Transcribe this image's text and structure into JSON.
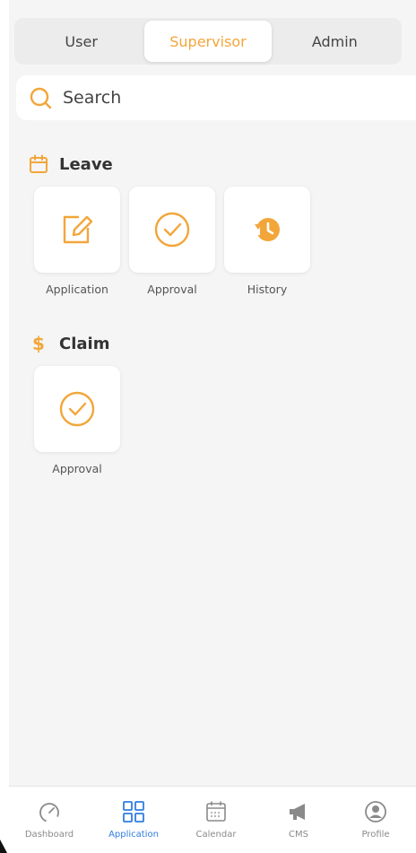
{
  "tabs": {
    "user": "User",
    "supervisor": "Supervisor",
    "admin": "Admin",
    "active": "supervisor"
  },
  "search": {
    "label": "Search"
  },
  "sections": {
    "leave": {
      "title": "Leave",
      "items": [
        {
          "label": "Application",
          "icon": "edit-icon"
        },
        {
          "label": "Approval",
          "icon": "check-circle-icon"
        },
        {
          "label": "History",
          "icon": "history-icon"
        }
      ]
    },
    "claim": {
      "title": "Claim",
      "items": [
        {
          "label": "Approval",
          "icon": "check-circle-icon"
        }
      ]
    }
  },
  "bottom_nav": {
    "items": [
      {
        "label": "Dashboard",
        "icon": "gauge-icon"
      },
      {
        "label": "Application",
        "icon": "grid-icon"
      },
      {
        "label": "Calendar",
        "icon": "calendar-icon"
      },
      {
        "label": "CMS",
        "icon": "megaphone-icon"
      },
      {
        "label": "Profile",
        "icon": "user-circle-icon"
      }
    ],
    "active": "Application"
  },
  "colors": {
    "accent": "#f2a63a",
    "nav_active": "#2f7de1",
    "nav_inactive": "#8a8a8a",
    "background": "#f5f5f5"
  }
}
